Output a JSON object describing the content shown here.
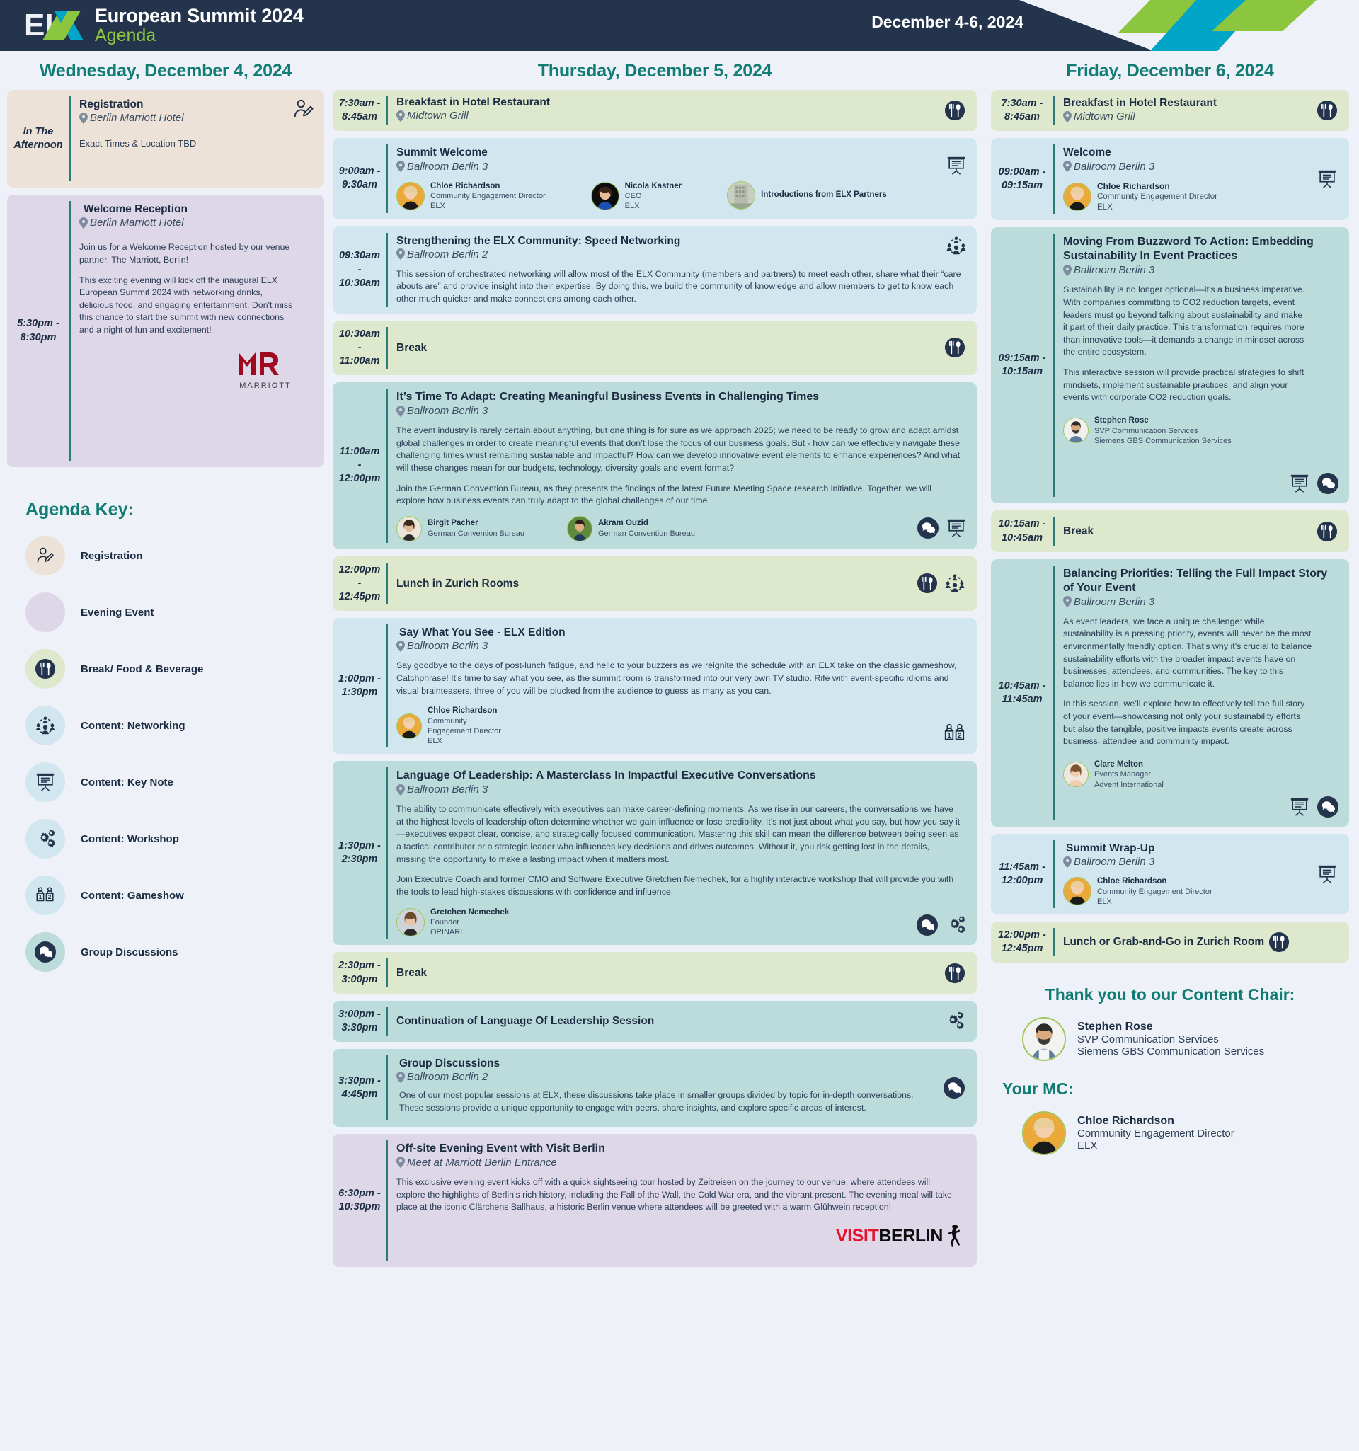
{
  "header": {
    "logo_text_el": "EL",
    "logo_text_x": "X",
    "title": "European Summit 2024",
    "subtitle": "Agenda",
    "date_range": "December 4-6, 2024"
  },
  "colors": {
    "header_bg": "#24344d",
    "accent_teal": "#107c74",
    "accent_green": "#8cc63f",
    "accent_cyan": "#00a5c8",
    "food_bg": "#dee8cd",
    "note_bg": "#d2e6ef",
    "teal_bg": "#bcdbdb",
    "evening_bg": "#ddd7e8",
    "registration_bg": "#ece2d8",
    "page_bg": "#eef1f8"
  },
  "wednesday": {
    "title": "Wednesday, December 4, 2024",
    "sessions": [
      {
        "time": "In The Afternoon",
        "type": "registration",
        "title": "Registration",
        "location": "Berlin Marriott Hotel",
        "note": "Exact Times & Location TBD",
        "icons": [
          "registration-icon"
        ]
      },
      {
        "time": "5:30pm - 8:30pm",
        "type": "evening",
        "title": "Welcome Reception",
        "location": "Berlin Marriott Hotel",
        "paragraphs": [
          "Join us for a Welcome Reception hosted by our venue partner, The Marriott, Berlin!",
          "This exciting evening will kick off the inaugural ELX European Summit 2024 with networking drinks, delicious food, and engaging entertainment. Don't miss this chance to start the summit with new connections and a night of fun and excitement!"
        ],
        "sponsor_logo": "MARRIOTT",
        "icons": []
      }
    ]
  },
  "agenda_key": {
    "title": "Agenda Key:",
    "items": [
      {
        "label": "Registration",
        "icon": "registration-icon",
        "circle": "#ece2d8"
      },
      {
        "label": "Evening Event",
        "icon": "none",
        "circle": "#ddd7e8"
      },
      {
        "label": "Break/ Food & Beverage",
        "icon": "food-icon",
        "circle": "#dee8cd"
      },
      {
        "label": "Content: Networking",
        "icon": "networking-icon",
        "circle": "#d2e6ef"
      },
      {
        "label": "Content: Key Note",
        "icon": "keynote-icon",
        "circle": "#d2e6ef"
      },
      {
        "label": "Content: Workshop",
        "icon": "workshop-icon",
        "circle": "#d2e6ef"
      },
      {
        "label": "Content: Gameshow",
        "icon": "gameshow-icon",
        "circle": "#d2e6ef"
      },
      {
        "label": "Group Discussions",
        "icon": "discussion-icon",
        "circle": "#bcdbdb"
      }
    ]
  },
  "thursday": {
    "title": "Thursday, December 5, 2024",
    "sessions": [
      {
        "time": "7:30am - 8:45am",
        "type": "food",
        "title": "Breakfast in Hotel Restaurant",
        "location": "Midtown Grill",
        "icons": [
          "food-icon"
        ]
      },
      {
        "time": "9:00am - 9:30am",
        "type": "note",
        "title": "Summit Welcome",
        "location": "Ballroom Berlin 3",
        "speakers": [
          {
            "name": "Chloe Richardson",
            "role": "Community Engagement Director",
            "org": "ELX",
            "avatar": "woman-blonde"
          },
          {
            "name": "Nicola Kastner",
            "role": "CEO",
            "org": "ELX",
            "avatar": "woman-dark"
          },
          {
            "name": "Introductions from ELX Partners",
            "role": "",
            "org": "",
            "avatar": "building"
          }
        ],
        "icons": [
          "keynote-icon"
        ]
      },
      {
        "time": "09:30am - 10:30am",
        "type": "note",
        "title": "Strengthening the ELX Community: Speed Networking",
        "location": "Ballroom Berlin 2",
        "paragraphs": [
          "This session of orchestrated networking will allow most of the ELX Community (members and partners) to meet each other, share what their “care abouts are” and provide insight into their expertise. By doing this, we build the community of knowledge and allow members to get to know each other much quicker and make connections among each other."
        ],
        "icons": [
          "networking-icon"
        ]
      },
      {
        "time": "10:30am - 11:00am",
        "type": "food",
        "title": "Break",
        "icons": [
          "food-icon"
        ]
      },
      {
        "time": "11:00am - 12:00pm",
        "type": "teal",
        "title": "It’s Time To Adapt: Creating Meaningful Business Events in Challenging Times",
        "location": "Ballroom Berlin 3",
        "paragraphs": [
          "The event industry is rarely certain about anything, but one thing is for sure as we approach 2025; we need to be ready to grow and adapt amidst global challenges in order to create meaningful events that don’t lose the focus of our business goals. But - how can we effectively navigate these challenging times whist remaining sustainable and impactful? How can we develop innovative event elements to enhance experiences? And what will these changes mean for our budgets, technology, diversity goals and event format?",
          "Join the German Convention Bureau, as they presents the findings of the latest Future Meeting Space research initiative. Together, we will explore how business events can truly adapt to the global challenges of our time."
        ],
        "speakers": [
          {
            "name": "Birgit Pacher",
            "role": "German Convention Bureau",
            "org": "",
            "avatar": "woman-dark2"
          },
          {
            "name": "Akram Ouzid",
            "role": "German Convention Bureau",
            "org": "",
            "avatar": "man-green"
          }
        ],
        "icons": [
          "discussion-icon",
          "keynote-icon"
        ]
      },
      {
        "time": "12:00pm - 12:45pm",
        "type": "food",
        "title": "Lunch in Zurich Rooms",
        "icons": [
          "food-icon",
          "networking-icon"
        ]
      },
      {
        "time": "1:00pm - 1:30pm",
        "type": "note",
        "title": "Say What You See -  ELX Edition",
        "location": "Ballroom Berlin 3",
        "paragraphs": [
          "Say goodbye to the days of post-lunch fatigue, and hello to your buzzers as we reignite the schedule with an ELX take on the classic gameshow, Catchphrase! It’s time to say what you see, as the summit room is transformed into our very own TV studio. Rife with event-specific idioms and visual brainteasers, three of you will be plucked from the audience to guess as many as you can."
        ],
        "speakers": [
          {
            "name": "Chloe Richardson",
            "role": "Community",
            "org": "Engagement Director",
            "org2": "ELX",
            "avatar": "woman-blonde"
          }
        ],
        "icons": [
          "gameshow-icon"
        ]
      },
      {
        "time": "1:30pm - 2:30pm",
        "type": "teal",
        "title": "Language Of Leadership: A Masterclass In Impactful Executive Conversations",
        "location": "Ballroom Berlin 3",
        "paragraphs": [
          "The ability to communicate effectively with executives can make career-defining moments. As we rise in our careers, the conversations we have at the highest levels of leadership often determine whether we gain influence or lose credibility. It’s not just about what you say, but how you say it—executives expect clear, concise, and strategically focused communication. Mastering this skill can mean the difference between being seen as a tactical contributor or a strategic leader who influences key decisions and drives outcomes. Without it, you risk getting lost in the details, missing the opportunity to make a lasting impact when it matters most.",
          "Join Executive Coach and former CMO and Software Executive Gretchen Nemechek, for a highly interactive workshop that will provide you with the tools to lead high-stakes discussions with confidence and influence."
        ],
        "speakers": [
          {
            "name": "Gretchen Nemechek",
            "role": "Founder",
            "org": "OPINARI",
            "avatar": "woman-brown"
          }
        ],
        "icons": [
          "discussion-icon",
          "workshop-icon"
        ]
      },
      {
        "time": "2:30pm - 3:00pm",
        "type": "food",
        "title": "Break",
        "icons": [
          "food-icon"
        ]
      },
      {
        "time": "3:00pm - 3:30pm",
        "type": "teal",
        "title": "Continuation of Language Of Leadership Session",
        "icons": [
          "workshop-icon"
        ]
      },
      {
        "time": "3:30pm - 4:45pm",
        "type": "teal",
        "title": "Group Discussions",
        "location": "Ballroom Berlin 2",
        "paragraphs": [
          "One of our most popular sessions at ELX, these discussions take place in smaller groups divided by topic for in-depth conversations. These sessions provide a unique opportunity to engage with peers, share insights, and explore specific areas of interest."
        ],
        "icons": [
          "discussion-icon"
        ]
      },
      {
        "time": "6:30pm - 10:30pm",
        "type": "evening",
        "title": "Off-site Evening Event with Visit Berlin",
        "location": "Meet at Marriott Berlin Entrance",
        "paragraphs": [
          "This exclusive evening event kicks off with a quick sightseeing tour hosted by Zeitreisen on the journey to our venue, where attendees will explore the highlights of Berlin’s rich history, including the Fall of the Wall, the Cold War era, and the vibrant present. The evening meal will take place at the iconic Clärchens Ballhaus, a historic Berlin venue where attendees will be greeted with a warm Glühwein reception!"
        ],
        "sponsor_visit": "VISIT",
        "sponsor_berlin": "BERLIN",
        "icons": []
      }
    ]
  },
  "friday": {
    "title": "Friday, December 6, 2024",
    "sessions": [
      {
        "time": "7:30am - 8:45am",
        "type": "food",
        "title": "Breakfast in Hotel Restaurant",
        "location": "Midtown Grill",
        "icons": [
          "food-icon"
        ]
      },
      {
        "time": "09:00am - 09:15am",
        "type": "note",
        "title": "Welcome",
        "location": "Ballroom Berlin 3",
        "speakers": [
          {
            "name": "Chloe Richardson",
            "role": "Community Engagement Director",
            "org": "ELX",
            "avatar": "woman-blonde"
          }
        ],
        "icons": [
          "keynote-icon"
        ]
      },
      {
        "time": "09:15am - 10:15am",
        "type": "teal",
        "title": "Moving From Buzzword To Action: Embedding Sustainability In Event Practices",
        "location": "Ballroom Berlin 3",
        "paragraphs": [
          "Sustainability is no longer optional—it's a business imperative. With companies committing to CO2 reduction targets, event leaders must go beyond talking about sustainability and make it part of their daily practice. This transformation requires more than innovative tools—it demands a change in mindset across the entire ecosystem.",
          "This interactive session will provide practical strategies to shift mindsets, implement sustainable practices, and align your events with corporate CO2 reduction goals."
        ],
        "speakers": [
          {
            "name": "Stephen Rose",
            "role": "SVP Communication Services",
            "org": "Siemens GBS Communication Services",
            "avatar": "man-beard"
          }
        ],
        "icons": [
          "keynote-icon",
          "discussion-icon"
        ]
      },
      {
        "time": "10:15am - 10:45am",
        "type": "food",
        "title": "Break",
        "icons": [
          "food-icon"
        ]
      },
      {
        "time": "10:45am - 11:45am",
        "type": "teal",
        "title": "Balancing Priorities: Telling the Full Impact Story of Your Event",
        "location": "Ballroom Berlin 3",
        "paragraphs": [
          "As event leaders, we face a unique challenge: while sustainability is a pressing priority, events will never be the most environmentally friendly option. That’s why it’s crucial to balance sustainability efforts with the broader impact events have on businesses, attendees, and communities. The key to this balance lies in how we communicate it.",
          "In this session, we’ll explore how to effectively tell the full story of your event—showcasing not only your sustainability efforts but also the tangible, positive impacts events create across business, attendee and community impact."
        ],
        "speakers": [
          {
            "name": "Clare Melton",
            "role": "Events Manager",
            "org": "Advent International",
            "avatar": "woman-light"
          }
        ],
        "icons": [
          "keynote-icon",
          "discussion-icon"
        ]
      },
      {
        "time": "11:45am - 12:00pm",
        "type": "note",
        "title": "Summit Wrap-Up",
        "location": "Ballroom Berlin 3",
        "speakers": [
          {
            "name": "Chloe Richardson",
            "role": "Community Engagement Director",
            "org": "ELX",
            "avatar": "woman-blonde"
          }
        ],
        "icons": [
          "keynote-icon"
        ]
      },
      {
        "time": "12:00pm - 12:45pm",
        "type": "food",
        "title": "Lunch or Grab-and-Go in Zurich Room",
        "icons": [
          "food-icon"
        ]
      }
    ],
    "content_chair": {
      "title": "Thank you to our Content Chair:",
      "name": "Stephen Rose",
      "role": "SVP Communication Services",
      "org": "Siemens GBS Communication Services"
    },
    "mc": {
      "title": "Your MC:",
      "name": "Chloe Richardson",
      "role": "Community Engagement Director",
      "org": "ELX"
    }
  }
}
